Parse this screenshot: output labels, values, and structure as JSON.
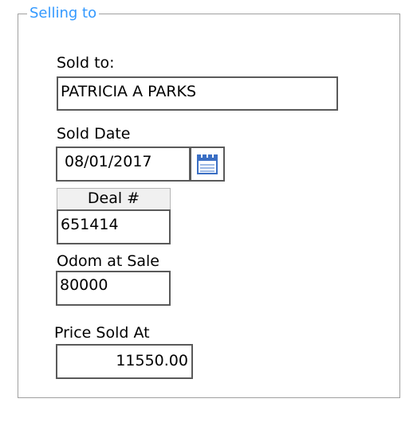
{
  "group": {
    "title": "Selling to"
  },
  "sold_to": {
    "label": "Sold to:",
    "value": "PATRICIA A PARKS"
  },
  "sold_date": {
    "label": "Sold Date",
    "value": "08/01/2017",
    "button_icon": "calendar-icon"
  },
  "deal": {
    "header": "Deal #",
    "value": "651414"
  },
  "odometer": {
    "label": "Odom at Sale",
    "value": "80000"
  },
  "price": {
    "label": "Price Sold At",
    "value": "11550.00"
  },
  "colors": {
    "group_title": "#3399ff",
    "calendar_icon": "#3b6fc4"
  }
}
